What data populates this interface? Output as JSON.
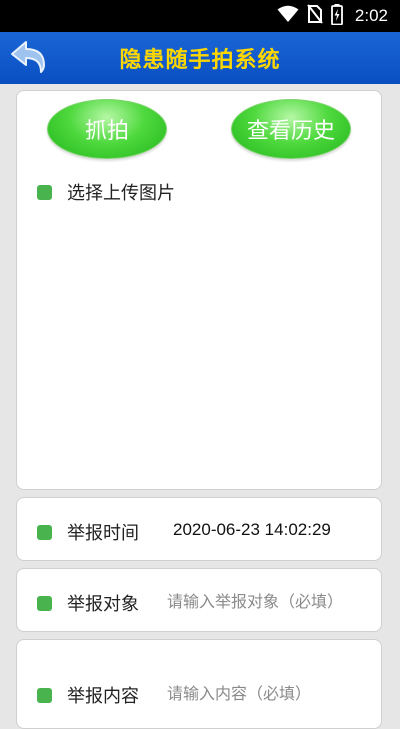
{
  "status_bar": {
    "time": "2:02",
    "icons": [
      "wifi-icon",
      "no-sim-icon",
      "battery-charging-icon"
    ]
  },
  "header": {
    "title": "隐患随手拍系统",
    "back_icon": "back-arrow-icon"
  },
  "photo_card": {
    "capture_label": "抓拍",
    "history_label": "查看历史",
    "select_label": "选择上传图片"
  },
  "form": {
    "time_label": "举报时间",
    "time_value": "2020-06-23 14:02:29",
    "target_label": "举报对象",
    "target_placeholder": "请输入举报对象（必填）",
    "content_label": "举报内容",
    "content_placeholder": "请输入内容（必填）"
  },
  "colors": {
    "title_bar": "#0a4fc2",
    "title_text": "#ffd700",
    "bullet": "#49b34d",
    "button_green": "#3fcf33"
  }
}
